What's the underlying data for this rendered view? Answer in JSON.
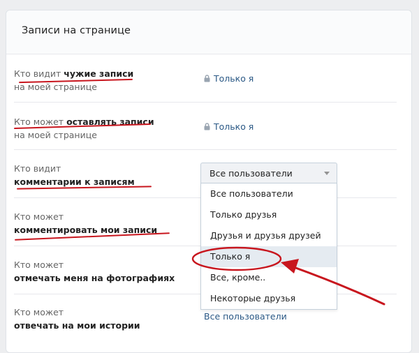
{
  "section_title": "Записи на странице",
  "rows": [
    {
      "line1_plain": "Кто видит ",
      "line1_bold": "чужие записи",
      "line2_plain": "на моей странице",
      "value": "Только я",
      "locked": true
    },
    {
      "line1_plain": "Кто может ",
      "line1_bold": "оставлять записи",
      "line2_plain": "на моей странице",
      "value": "Только я",
      "locked": true
    },
    {
      "line1_plain": "Кто видит",
      "line2_bold": "комментарии к записям"
    },
    {
      "line1_plain": "Кто может",
      "line2_bold": "комментировать мои записи"
    },
    {
      "line1_plain": "Кто может",
      "line2_bold": "отмечать меня на фотографиях"
    },
    {
      "line1_plain": "Кто может",
      "line2_bold": "отвечать на мои истории",
      "value": "Все пользователи"
    }
  ],
  "dropdown": {
    "selected": "Все пользователи",
    "options": [
      "Все пользователи",
      "Только друзья",
      "Друзья и друзья друзей",
      "Только я",
      "Все, кроме..",
      "Некоторые друзья"
    ],
    "highlighted": "Только я"
  },
  "colors": {
    "link": "#2a5885",
    "annotation": "#c8161e",
    "highlight": "#e5ebf1"
  },
  "icons": {
    "lock": "lock-icon",
    "caret": "chevron-down-icon"
  }
}
